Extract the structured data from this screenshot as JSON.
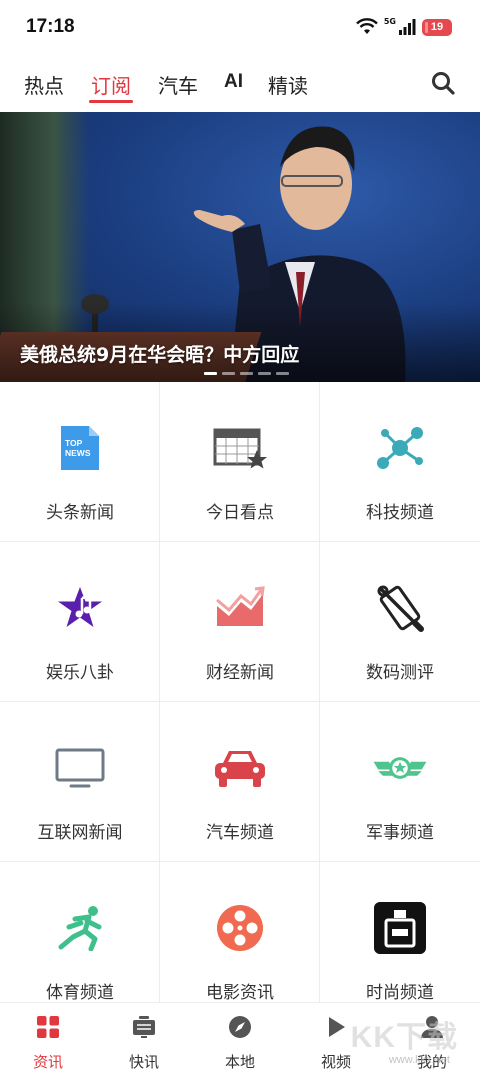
{
  "status_bar": {
    "time": "17:18",
    "network": "5G",
    "battery": "19"
  },
  "top_nav": {
    "tabs": [
      {
        "label": "热点",
        "active": false
      },
      {
        "label": "订阅",
        "active": true
      },
      {
        "label": "汽车",
        "active": false
      },
      {
        "label": "AI",
        "active": false
      },
      {
        "label": "精读",
        "active": false
      }
    ],
    "search_icon": "search-icon",
    "accent_color": "#e0383e"
  },
  "banner": {
    "caption": "美俄总统9月在华会晤？中方回应",
    "slide_count": 5,
    "active_slide": 1
  },
  "channels": [
    {
      "label": "头条新闻",
      "icon": "top-news-icon",
      "color": "#3d9be9"
    },
    {
      "label": "今日看点",
      "icon": "calendar-star-icon",
      "color": "#555555"
    },
    {
      "label": "科技频道",
      "icon": "network-nodes-icon",
      "color": "#3aa9b8"
    },
    {
      "label": "娱乐八卦",
      "icon": "music-star-icon",
      "color": "#5b1fae"
    },
    {
      "label": "财经新闻",
      "icon": "finance-chart-icon",
      "color": "#e96a6a"
    },
    {
      "label": "数码测评",
      "icon": "phone-tools-icon",
      "color": "#222222"
    },
    {
      "label": "互联网新闻",
      "icon": "monitor-icon",
      "color": "#6f7a87"
    },
    {
      "label": "汽车频道",
      "icon": "car-icon",
      "color": "#d9444b"
    },
    {
      "label": "军事频道",
      "icon": "military-badge-icon",
      "color": "#4fc48e"
    },
    {
      "label": "体育频道",
      "icon": "runner-icon",
      "color": "#3fbf8c"
    },
    {
      "label": "电影资讯",
      "icon": "film-reel-icon",
      "color": "#ef6a50"
    },
    {
      "label": "时尚频道",
      "icon": "perfume-icon",
      "color": "#111111"
    }
  ],
  "bottom_nav": [
    {
      "label": "资讯",
      "icon": "grid-icon",
      "active": true
    },
    {
      "label": "快讯",
      "icon": "tv-icon",
      "active": false
    },
    {
      "label": "本地",
      "icon": "compass-icon",
      "active": false
    },
    {
      "label": "视频",
      "icon": "play-icon",
      "active": false
    },
    {
      "label": "我的",
      "icon": "user-icon",
      "active": false
    }
  ],
  "watermark": {
    "text": "KK下载",
    "url": "www.kkx.net"
  }
}
